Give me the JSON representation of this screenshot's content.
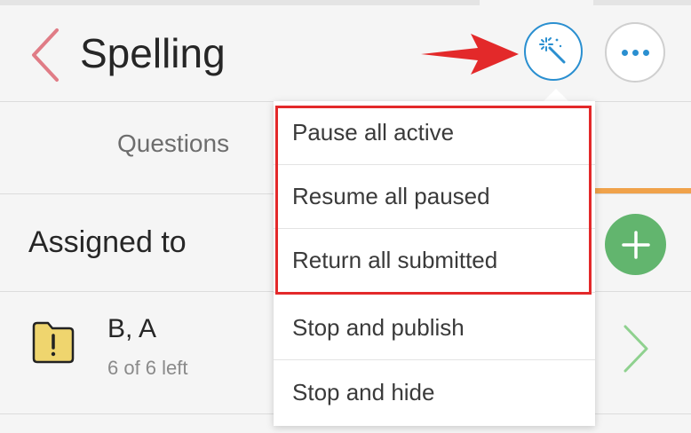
{
  "header": {
    "title": "Spelling",
    "icons": {
      "back": "chevron-left-icon",
      "magic": "magic-wand-icon",
      "more": "more-dots-icon"
    }
  },
  "tabs": [
    {
      "label": "Questions"
    }
  ],
  "assigned": {
    "label": "Assigned to",
    "add_icon": "plus-icon"
  },
  "students": [
    {
      "name": "B, A",
      "status": "6 of 6 left",
      "icon": "folder-alert-icon"
    }
  ],
  "dropdown": {
    "items": [
      {
        "label": "Pause all active"
      },
      {
        "label": "Resume all paused"
      },
      {
        "label": "Return all submitted"
      },
      {
        "label": "Stop and publish"
      },
      {
        "label": "Stop and hide"
      }
    ]
  },
  "colors": {
    "accent_blue": "#2a8fd0",
    "back_chevron": "#e07c86",
    "add_green": "#62b56e",
    "tab_underline": "#f0a24a",
    "annotation_red": "#e3292a",
    "folder_yellow": "#efd56e",
    "row_chevron": "#8fd18f"
  }
}
